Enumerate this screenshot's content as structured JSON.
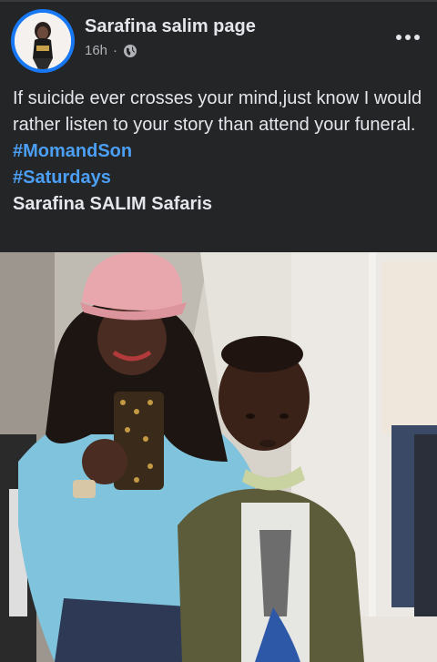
{
  "post": {
    "page_name": "Sarafina salim page",
    "time": "16h",
    "separator": "·",
    "privacy_icon": "globe-icon",
    "more_icon": "more-horizontal-icon",
    "text_line_1": "If suicide ever crosses your mind,just know I would rather listen to your story than attend  your funeral.",
    "hashtags": [
      "#MomandSon",
      "#Saturdays"
    ],
    "tagline": "Sarafina SALIM Safaris"
  },
  "colors": {
    "background": "#242526",
    "text": "#e4e6eb",
    "secondary_text": "#b0b3b8",
    "hashtag": "#4b9ff5",
    "avatar_ring": "#1877f2"
  }
}
